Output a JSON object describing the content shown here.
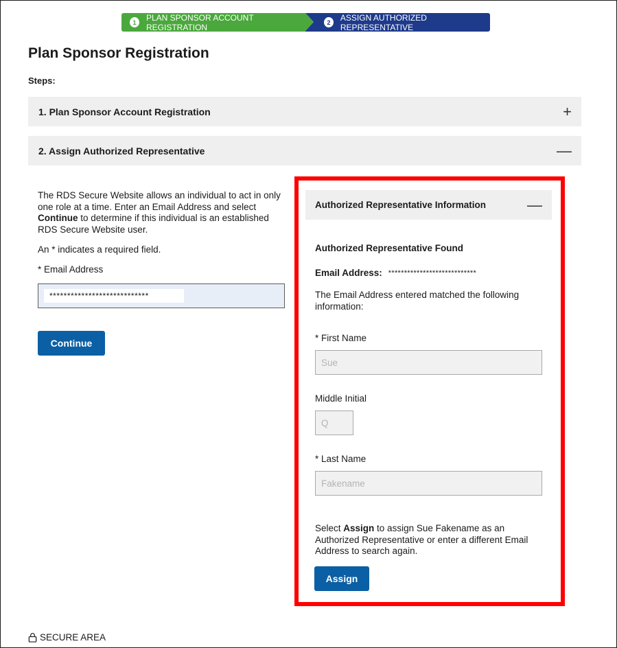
{
  "stepper": {
    "steps": [
      {
        "number": "1",
        "label": "PLAN SPONSOR ACCOUNT REGISTRATION",
        "color": "#4aa83c"
      },
      {
        "number": "2",
        "label": "ASSIGN AUTHORIZED REPRESENTATIVE",
        "color": "#1e3a8a"
      }
    ]
  },
  "page_title": "Plan Sponsor Registration",
  "steps_label": "Steps:",
  "accordions": [
    {
      "label": "1. Plan Sponsor Account Registration",
      "icon": "plus-icon",
      "glyph": "+"
    },
    {
      "label": "2. Assign Authorized Representative",
      "icon": "minus-icon",
      "glyph": "—"
    }
  ],
  "left": {
    "intro_pre": "The RDS Secure Website allows an individual to act in only one role at a time. Enter an Email Address and select ",
    "intro_bold": "Continue",
    "intro_post": " to determine if this individual is an established RDS Secure Website user.",
    "required_note": "An * indicates a required field.",
    "email_label": "* Email Address",
    "email_value": "****************************",
    "continue_label": "Continue"
  },
  "panel": {
    "title": "Authorized Representative Information",
    "collapse_glyph": "—",
    "found_heading": "Authorized Representative Found",
    "email_label": "Email Address:",
    "email_value": "****************************",
    "matched_text": "The Email Address entered matched the following information:",
    "first_name_label": "* First Name",
    "first_name_value": "Sue",
    "middle_initial_label": "Middle Initial",
    "middle_initial_value": "Q",
    "last_name_label": "* Last Name",
    "last_name_value": "Fakename",
    "assign_pre": "Select ",
    "assign_bold": "Assign",
    "assign_post": " to assign Sue Fakename as an Authorized Representative or enter a different Email Address to search again.",
    "assign_label": "Assign",
    "highlight_color": "#ff0000"
  },
  "footer": {
    "secure_label": "SECURE AREA"
  }
}
